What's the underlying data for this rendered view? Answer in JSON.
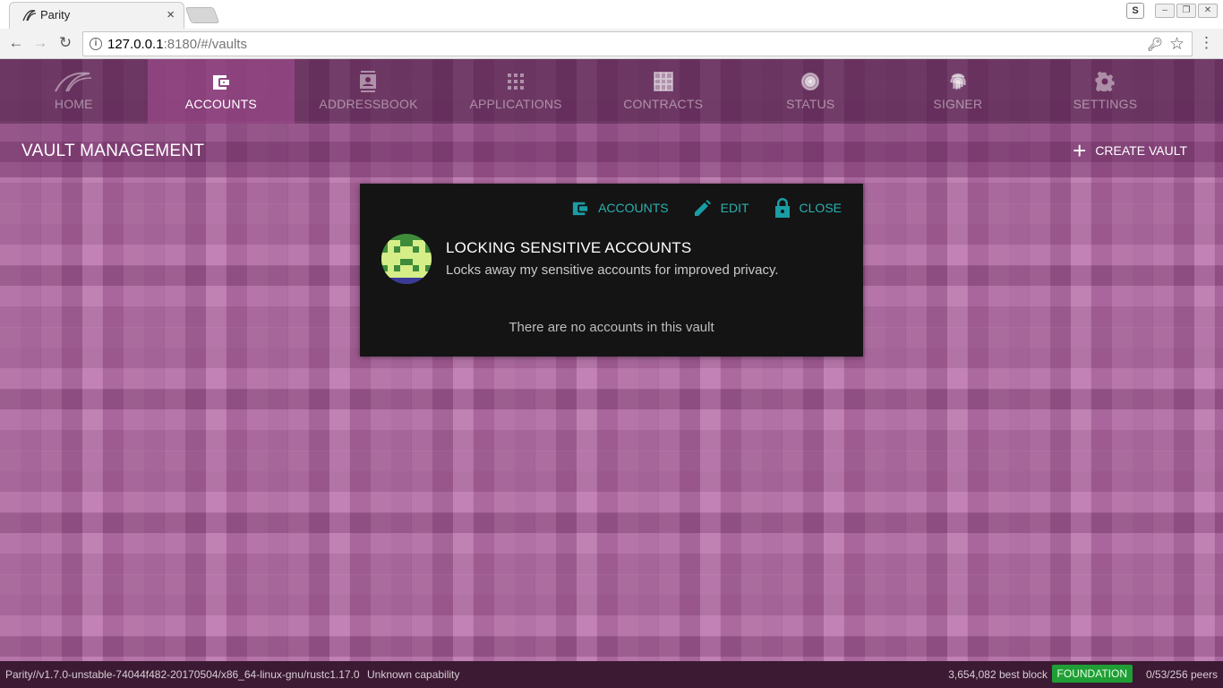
{
  "browser": {
    "tab_title": "Parity",
    "tab_close": "×",
    "url_host": "127.0.0.1",
    "url_rest": ":8180/#/vaults",
    "ext_badge": "S"
  },
  "nav": {
    "items": [
      {
        "label": "HOME",
        "icon": "parity-logo-icon",
        "active": false
      },
      {
        "label": "ACCOUNTS",
        "icon": "wallet-icon",
        "active": true
      },
      {
        "label": "ADDRESSBOOK",
        "icon": "contact-card-icon",
        "active": false
      },
      {
        "label": "APPLICATIONS",
        "icon": "apps-grid-icon",
        "active": false
      },
      {
        "label": "CONTRACTS",
        "icon": "contract-grid-icon",
        "active": false
      },
      {
        "label": "STATUS",
        "icon": "radar-icon",
        "active": false
      },
      {
        "label": "SIGNER",
        "icon": "fingerprint-icon",
        "active": false
      },
      {
        "label": "SETTINGS",
        "icon": "gear-icon",
        "active": false
      }
    ]
  },
  "page": {
    "title": "VAULT MANAGEMENT",
    "create_vault_label": "CREATE VAULT"
  },
  "vault": {
    "actions": {
      "accounts": "ACCOUNTS",
      "edit": "EDIT",
      "close": "CLOSE"
    },
    "name": "LOCKING SENSITIVE ACCOUNTS",
    "description": "Locks away my sensitive accounts for improved privacy.",
    "empty_message": "There are no accounts in this vault"
  },
  "status_bar": {
    "version": "Parity//v1.7.0-unstable-74044f482-20170504/x86_64-linux-gnu/rustc1.17.0",
    "capability": "Unknown capability",
    "best_block": "3,654,082 best block",
    "chain": "FOUNDATION",
    "peers": "0/53/256 peers"
  },
  "colors": {
    "accent": "#1a9da5",
    "chain_badge": "#1f9e35",
    "background": "#b0609f"
  }
}
